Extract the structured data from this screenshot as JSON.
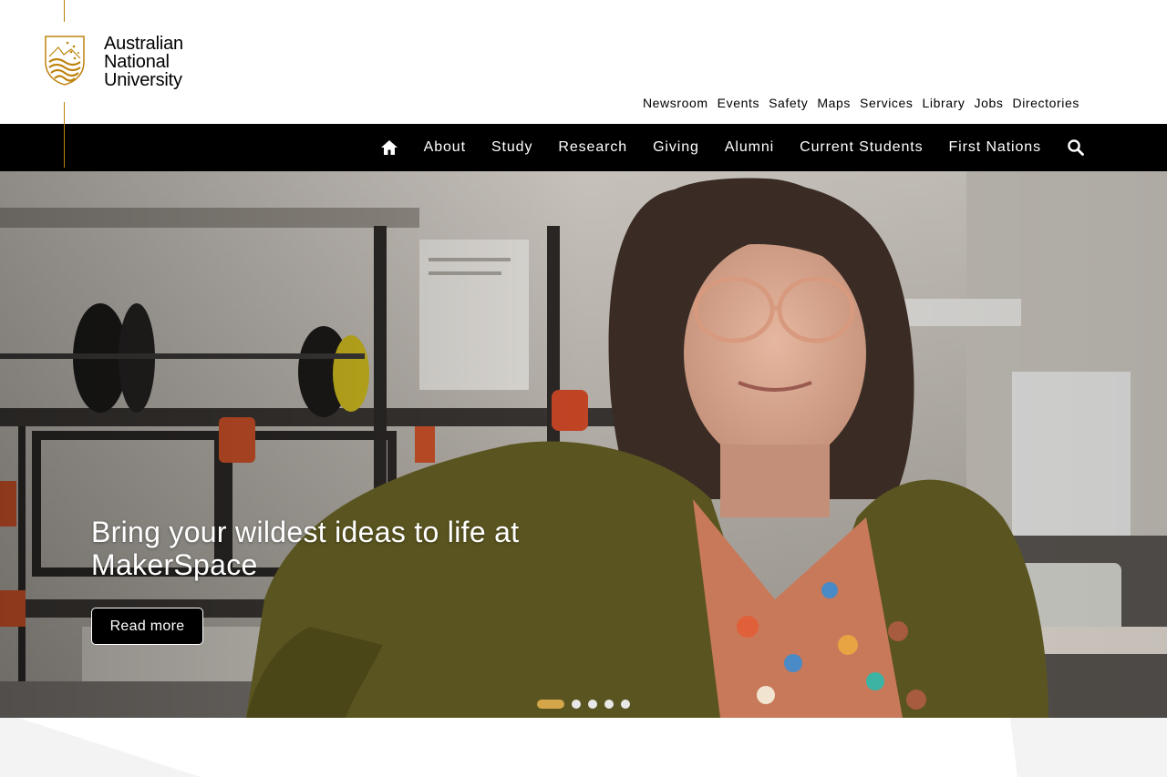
{
  "logo": {
    "line1": "Australian",
    "line2": "National",
    "line3": "University"
  },
  "utility_nav": [
    "Newsroom",
    "Events",
    "Safety",
    "Maps",
    "Services",
    "Library",
    "Jobs",
    "Directories"
  ],
  "main_nav": {
    "home_icon": "home-icon",
    "items": [
      "About",
      "Study",
      "Research",
      "Giving",
      "Alumni",
      "Current Students",
      "First Nations"
    ],
    "search_icon": "search-icon"
  },
  "hero": {
    "title": "Bring your wildest ideas to life at MakerSpace",
    "button_label": "Read more",
    "slides_count": 5,
    "active_slide": 1
  },
  "colors": {
    "accent_gold": "#be830e",
    "active_dot": "#d4a649",
    "nav_background": "#000000"
  }
}
